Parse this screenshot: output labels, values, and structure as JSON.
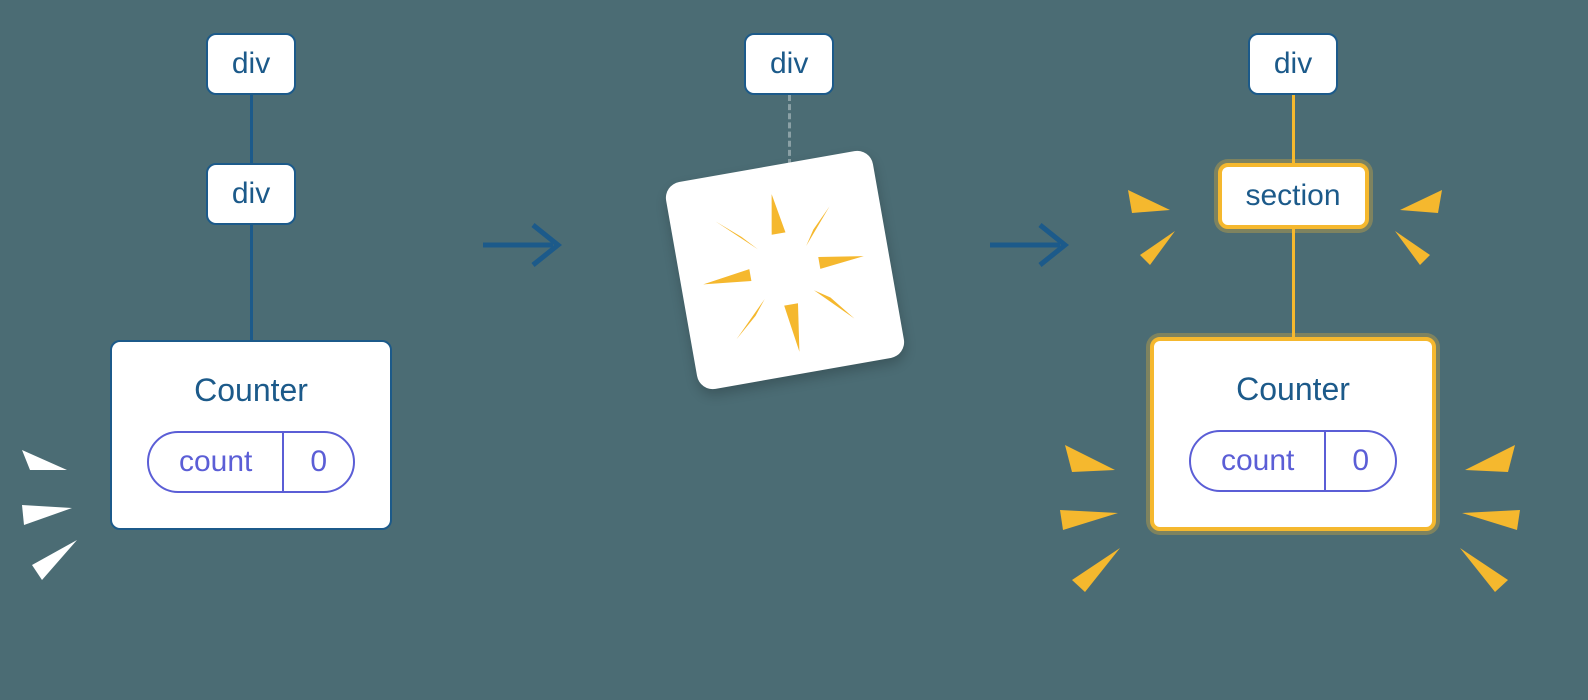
{
  "left_tree": {
    "node1": "div",
    "node2": "div",
    "counter_title": "Counter",
    "state_key": "count",
    "state_value": "0"
  },
  "right_tree": {
    "node1": "div",
    "node2": "section",
    "counter_title": "Counter",
    "state_key": "count",
    "state_value": "0"
  },
  "middle_tree": {
    "node1": "div"
  }
}
